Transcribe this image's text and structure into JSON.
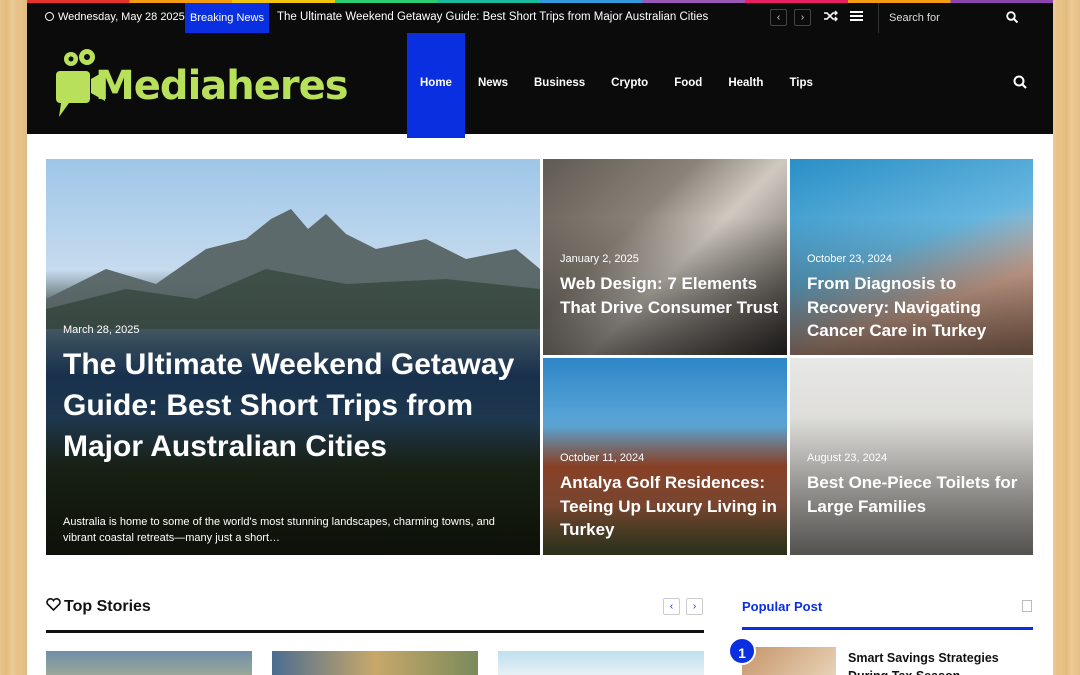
{
  "topbar": {
    "date": "Wednesday, May 28 2025",
    "breaking_label": "Breaking News",
    "ticker": "The Ultimate Weekend Getaway Guide: Best Short Trips from Major Australian Cities",
    "prev": "‹",
    "next": "›",
    "search_placeholder": "Search for"
  },
  "header": {
    "logo_text": "Mediaheres",
    "nav": [
      "Home",
      "News",
      "Business",
      "Crypto",
      "Food",
      "Health",
      "Tips"
    ]
  },
  "hero": {
    "main": {
      "date": "March 28, 2025",
      "title": "The Ultimate Weekend Getaway Guide: Best Short Trips from Major Australian Cities",
      "excerpt": "Australia is home to some of the world's most stunning landscapes, charming towns, and vibrant coastal retreats—many just a short…"
    },
    "tiles": [
      {
        "date": "January 2, 2025",
        "title": "Web Design: 7 Elements That Drive Consumer Trust"
      },
      {
        "date": "October 23, 2024",
        "title": "From Diagnosis to Recovery: Navigating Cancer Care in Turkey"
      },
      {
        "date": "October 11, 2024",
        "title": "Antalya Golf Residences: Teeing Up Luxury Living in Turkey"
      },
      {
        "date": "August 23, 2024",
        "title": " Best One-Piece Toilets for Large Families"
      }
    ]
  },
  "top_stories": {
    "title": "Top Stories",
    "prev": "‹",
    "next": "›"
  },
  "popular": {
    "title": "Popular Post",
    "items": [
      {
        "rank": "1",
        "title": "Smart Savings Strategies During Tax Season"
      }
    ]
  },
  "colors": {
    "accent": "#0a2fe0",
    "header_bg": "#0b0b0b",
    "logo_green": "#b8e05a"
  }
}
